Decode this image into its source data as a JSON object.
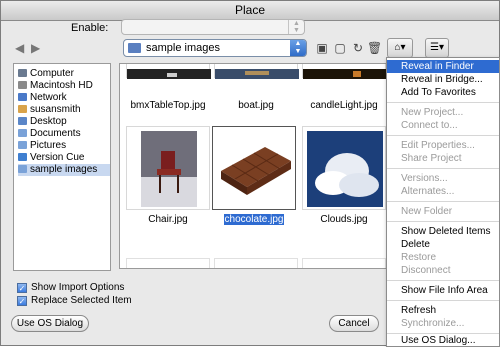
{
  "window": {
    "title": "Place"
  },
  "enable": {
    "label": "Enable:",
    "value": ""
  },
  "path": {
    "current": "sample images"
  },
  "sidebar": {
    "items": [
      {
        "label": "Computer",
        "icon": "computer-icon",
        "color": "#6a7a90"
      },
      {
        "label": "Macintosh HD",
        "icon": "hard-drive-icon",
        "color": "#8a8a8a"
      },
      {
        "label": "Network",
        "icon": "network-icon",
        "color": "#4a79c8"
      },
      {
        "label": "susansmith",
        "icon": "home-icon",
        "color": "#d9a34a"
      },
      {
        "label": "Desktop",
        "icon": "desktop-icon",
        "color": "#5a86c8"
      },
      {
        "label": "Documents",
        "icon": "documents-folder-icon",
        "color": "#7aa2d8"
      },
      {
        "label": "Pictures",
        "icon": "pictures-folder-icon",
        "color": "#7aa2d8"
      },
      {
        "label": "Version Cue",
        "icon": "version-cue-icon",
        "color": "#3f7fd0"
      },
      {
        "label": "sample images",
        "icon": "folder-icon",
        "color": "#7aa2d8"
      }
    ]
  },
  "files": {
    "top_row": [
      "bmxTableTop.jpg",
      "boat.jpg",
      "candleLight.jpg"
    ],
    "middle_row": [
      {
        "name": "Chair.jpg",
        "selected": false
      },
      {
        "name": "chocolate.jpg",
        "selected": true
      },
      {
        "name": "Clouds.jpg",
        "selected": false
      }
    ]
  },
  "options": {
    "show_import": {
      "label": "Show Import Options",
      "checked": true
    },
    "replace_selected": {
      "label": "Replace Selected Item",
      "checked": true
    }
  },
  "buttons": {
    "os_dialog": "Use OS Dialog",
    "cancel": "Cancel"
  },
  "context_menu": {
    "items": [
      {
        "label": "Reveal in Finder",
        "state": "highlighted"
      },
      {
        "label": "Reveal in Bridge...",
        "state": "enabled"
      },
      {
        "label": "Add To Favorites",
        "state": "enabled"
      },
      {
        "label": "New Project...",
        "state": "disabled"
      },
      {
        "label": "Connect to...",
        "state": "disabled"
      },
      {
        "label": "Edit Properties...",
        "state": "disabled"
      },
      {
        "label": "Share Project",
        "state": "disabled"
      },
      {
        "label": "Versions...",
        "state": "disabled"
      },
      {
        "label": "Alternates...",
        "state": "disabled"
      },
      {
        "label": "New Folder",
        "state": "disabled"
      },
      {
        "label": "Show Deleted Items",
        "state": "enabled"
      },
      {
        "label": "Delete",
        "state": "enabled"
      },
      {
        "label": "Restore",
        "state": "disabled"
      },
      {
        "label": "Disconnect",
        "state": "disabled"
      },
      {
        "label": "Show File Info Area",
        "state": "enabled"
      },
      {
        "label": "Refresh",
        "state": "enabled"
      },
      {
        "label": "Synchronize...",
        "state": "disabled"
      },
      {
        "label": "Use OS Dialog...",
        "state": "enabled"
      }
    ]
  },
  "colors": {
    "selection": "#2e6bd1",
    "sidebar_selection": "#c8d8f0"
  }
}
